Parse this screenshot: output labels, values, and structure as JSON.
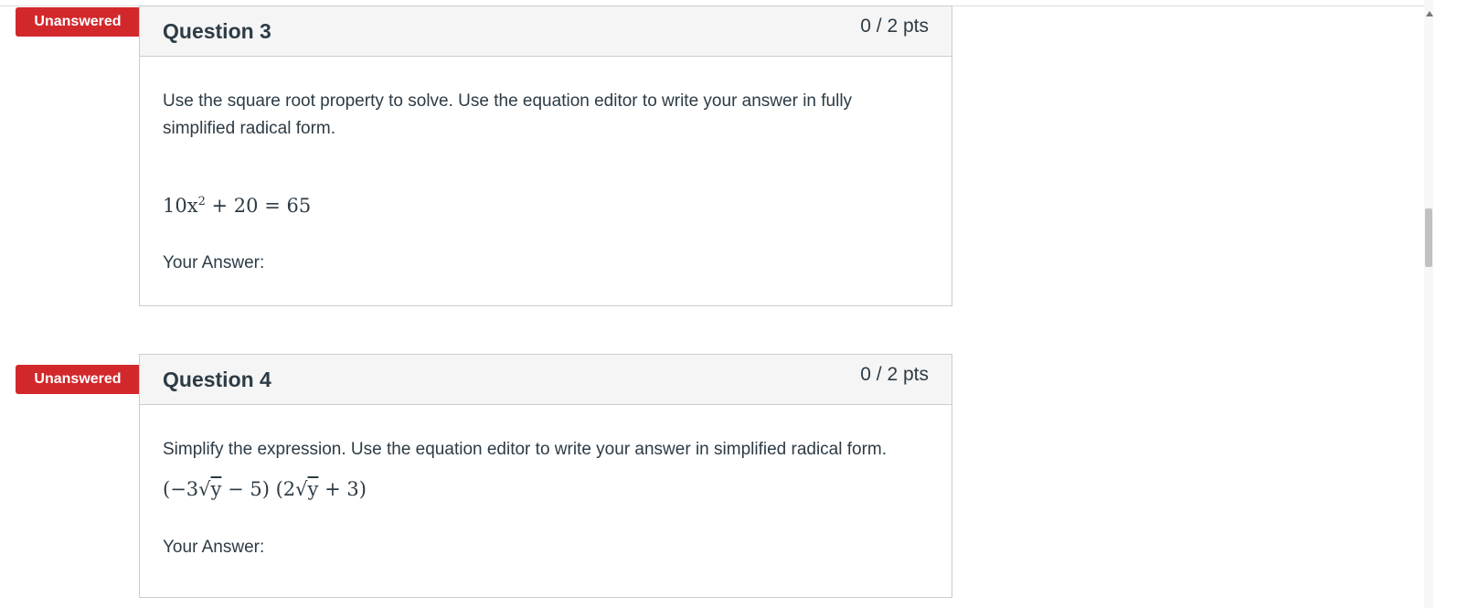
{
  "badge_label": "Unanswered",
  "questions": [
    {
      "title": "Question 3",
      "points": "0 / 2 pts",
      "text": "Use the square root property to solve. Use the equation editor to write your answer in fully simplified radical form.",
      "math": {
        "lhs_coef": "10x",
        "exponent": "2",
        "rest": " + 20 = 65"
      },
      "answer_label": "Your Answer:"
    },
    {
      "title": "Question 4",
      "points": "0 / 2 pts",
      "text": "Simplify the expression. Use the equation editor to write your answer in simplified radical form.",
      "math": {
        "part1_open": "(−3√",
        "part1_var": "y",
        "part1_close": " − 5) (2√",
        "part2_var": "y",
        "part2_close": " + 3)"
      },
      "answer_label": "Your Answer:"
    }
  ],
  "colors": {
    "badge": "#d2282c",
    "header_bg": "#f5f5f5",
    "border": "#c7cdd1",
    "text": "#2d3b45"
  }
}
